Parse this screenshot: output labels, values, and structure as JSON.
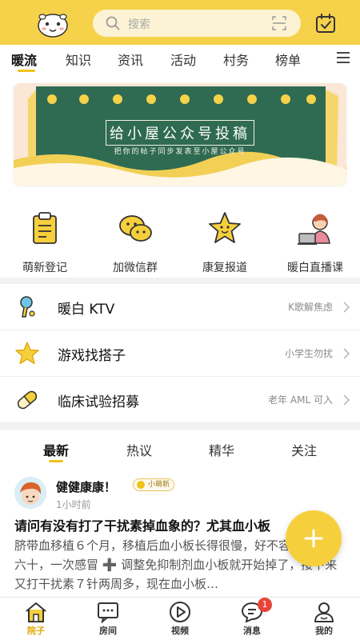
{
  "header": {
    "search_placeholder": "搜索"
  },
  "tabs": [
    {
      "label": "暖流",
      "active": true
    },
    {
      "label": "知识"
    },
    {
      "label": "资讯"
    },
    {
      "label": "活动"
    },
    {
      "label": "村务"
    },
    {
      "label": "榜单"
    }
  ],
  "banner": {
    "title": "给小屋公众号投稿",
    "subtitle": "把你的帖子同步发表至小屋公众号"
  },
  "quick_entries": [
    {
      "label": "萌新登记",
      "icon": "clipboard-icon"
    },
    {
      "label": "加微信群",
      "icon": "wechat-icon"
    },
    {
      "label": "康复报道",
      "icon": "star-icon"
    },
    {
      "label": "暖白直播课",
      "icon": "live-class-icon"
    }
  ],
  "list_rows": [
    {
      "title": "暖白 KTV",
      "note": "K歌解焦虑",
      "icon": "microphone-icon"
    },
    {
      "title": "游戏找搭子",
      "note": "小学生勿扰",
      "icon": "star-icon"
    },
    {
      "title": "临床试验招募",
      "note": "老年 AML 可入",
      "icon": "pill-icon"
    }
  ],
  "feed_tabs": [
    {
      "label": "最新",
      "active": true
    },
    {
      "label": "热议"
    },
    {
      "label": "精华"
    },
    {
      "label": "关注"
    }
  ],
  "post": {
    "username": "健健康康！",
    "badge": "小萌新",
    "time": "1小时前",
    "title": "请问有没有打了干扰素掉血象的？尤其血小板",
    "body": "脐带血移植６个月，移植后血小板长得很慢，好不容易长到五六十，一次感冒 ➕ 调整免抑制剂血小板就开始掉了，接下来又打干扰素７针两周多，现在血小板…"
  },
  "bottom_nav": [
    {
      "label": "院子",
      "icon": "home-icon",
      "active": true
    },
    {
      "label": "房间",
      "icon": "room-icon"
    },
    {
      "label": "视频",
      "icon": "video-icon"
    },
    {
      "label": "消息",
      "icon": "message-icon",
      "badge": "1"
    },
    {
      "label": "我的",
      "icon": "profile-icon"
    }
  ],
  "colors": {
    "brand_yellow": "#f6d24a",
    "accent": "#f2c21a",
    "banner_green": "#2f6b52",
    "badge_red": "#e8443a"
  }
}
